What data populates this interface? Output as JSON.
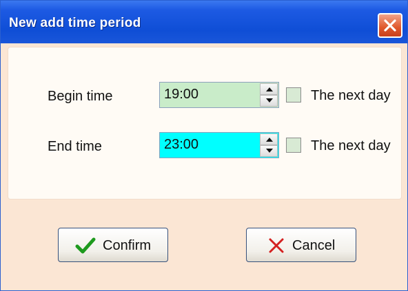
{
  "window": {
    "title": "New add time period"
  },
  "colors": {
    "titlebar": "#1d5ae3",
    "begin_field_bg": "#c9ecc9",
    "end_field_bg": "#00ffff",
    "dialog_bg": "#fbe6d4",
    "confirm_check": "#1e9a1e",
    "cancel_x": "#d42020"
  },
  "form": {
    "begin": {
      "label": "Begin time",
      "value": "19:00",
      "next_day_label": "The next day",
      "next_day_checked": false
    },
    "end": {
      "label": "End time",
      "value": "23:00",
      "next_day_label": "The next day",
      "next_day_checked": false
    }
  },
  "buttons": {
    "confirm": {
      "label": "Confirm",
      "icon": "check-icon"
    },
    "cancel": {
      "label": "Cancel",
      "icon": "x-icon"
    }
  }
}
